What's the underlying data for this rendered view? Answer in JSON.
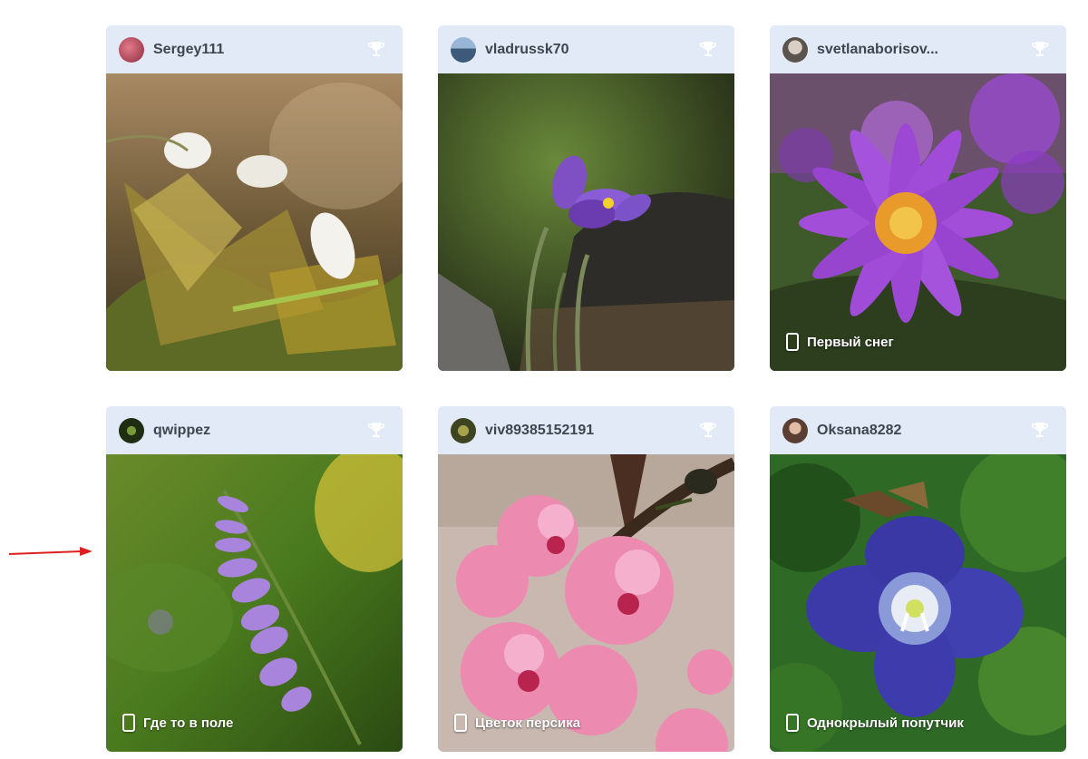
{
  "cards": [
    {
      "username": "Sergey111",
      "caption": "",
      "avatar_color": "#b0485a",
      "trophy_icon": "trophy-icon"
    },
    {
      "username": "vladrussk70",
      "caption": "",
      "avatar_color": "#4d6e94",
      "trophy_icon": "trophy-icon"
    },
    {
      "username": "svetlanaborisov...",
      "caption": "Первый снег",
      "avatar_color": "#6a625c",
      "trophy_icon": "trophy-icon"
    },
    {
      "username": "qwippez",
      "caption": "Где то в поле",
      "avatar_color": "#2d4a1c",
      "trophy_icon": "trophy-icon"
    },
    {
      "username": "viv89385152191",
      "caption": "Цветок персика",
      "avatar_color": "#55602a",
      "trophy_icon": "trophy-icon"
    },
    {
      "username": "Oksana8282",
      "caption": "Однокрылый попутчик",
      "avatar_color": "#7a5a4e",
      "trophy_icon": "trophy-icon"
    }
  ],
  "annotation": {
    "arrow_color": "#e02020",
    "icon": "red-arrow-icon"
  },
  "colors": {
    "header_bg": "#e1eaf6",
    "username_text": "#3e4650",
    "trophy": "#ffffff"
  }
}
